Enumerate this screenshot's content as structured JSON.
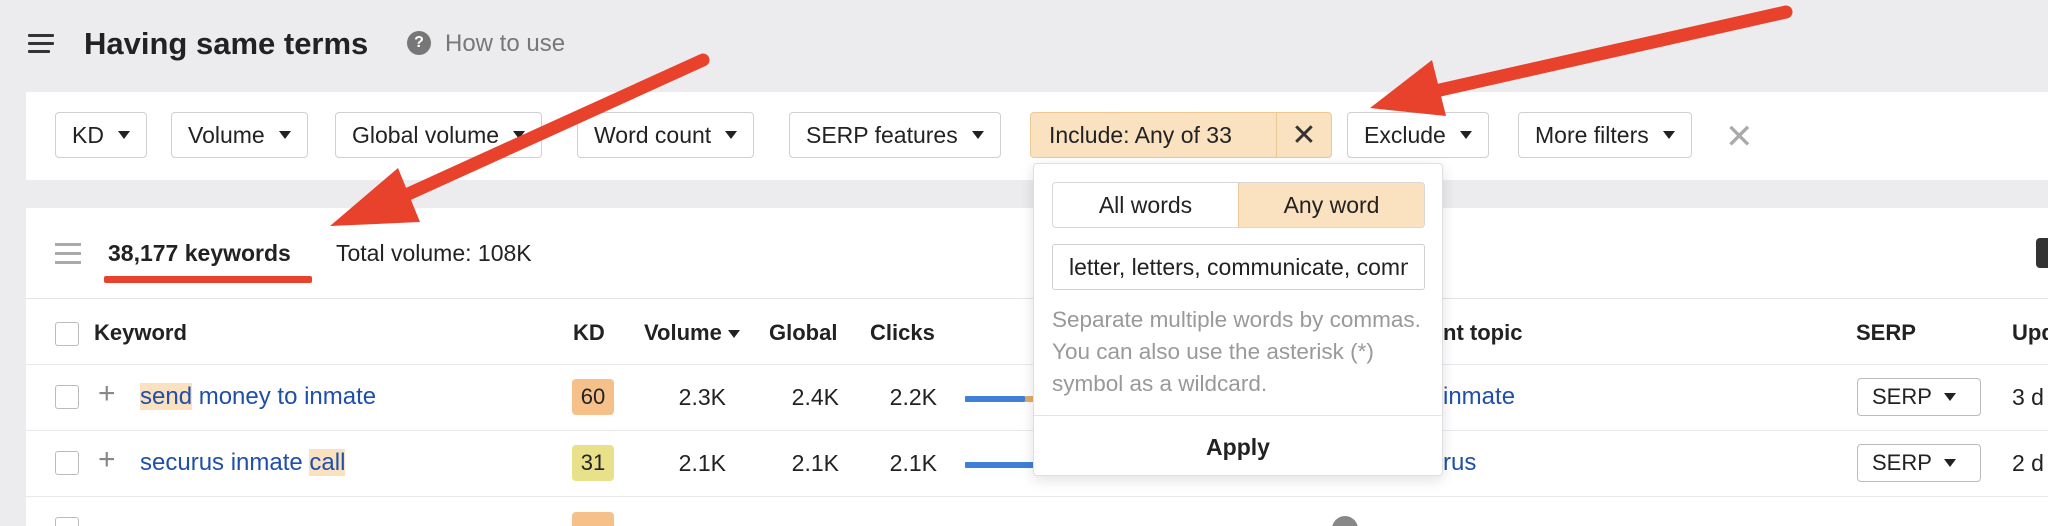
{
  "header": {
    "title": "Having same terms",
    "help_icon": "question-circle-icon",
    "help_label": "How to use"
  },
  "filters": {
    "kd": "KD",
    "volume": "Volume",
    "global_volume": "Global volume",
    "word_count": "Word count",
    "serp_features": "SERP features",
    "include": "Include: Any of 33",
    "exclude": "Exclude",
    "more_filters": "More filters"
  },
  "include_popup": {
    "all_words": "All words",
    "any_word": "Any word",
    "selected_mode": "Any word",
    "input_value": "letter, letters, communicate, communication",
    "hint": "Separate multiple words by commas. You can also use the asterisk (*) symbol as a wildcard.",
    "apply_label": "Apply"
  },
  "summary": {
    "keywords": "38,177 keywords",
    "total_volume": "Total volume: 108K"
  },
  "columns": {
    "keyword": "Keyword",
    "kd": "KD",
    "volume": "Volume",
    "global": "Global",
    "clicks": "Clicks",
    "parent_topic": "nt topic",
    "serp": "SERP",
    "updated": "Upd"
  },
  "rows": [
    {
      "kw_parts": [
        "send",
        " money to inmate"
      ],
      "kd": "60",
      "kd_color": "#f5c08a",
      "volume": "2.3K",
      "global": "2.4K",
      "clicks": "2.2K",
      "topic": "inmate",
      "serp": "SERP",
      "updated": "3 d"
    },
    {
      "kw_parts": [
        "securus inmate ",
        "call"
      ],
      "kd": "31",
      "kd_color": "#e9e08a",
      "volume": "2.1K",
      "global": "2.1K",
      "clicks": "2.1K",
      "topic": "rus",
      "serp": "SERP",
      "updated": "2 d"
    }
  ],
  "colors": {
    "accent_highlight": "#fae2c0",
    "link": "#1f4fa8",
    "annotation_red": "#e8412c"
  }
}
